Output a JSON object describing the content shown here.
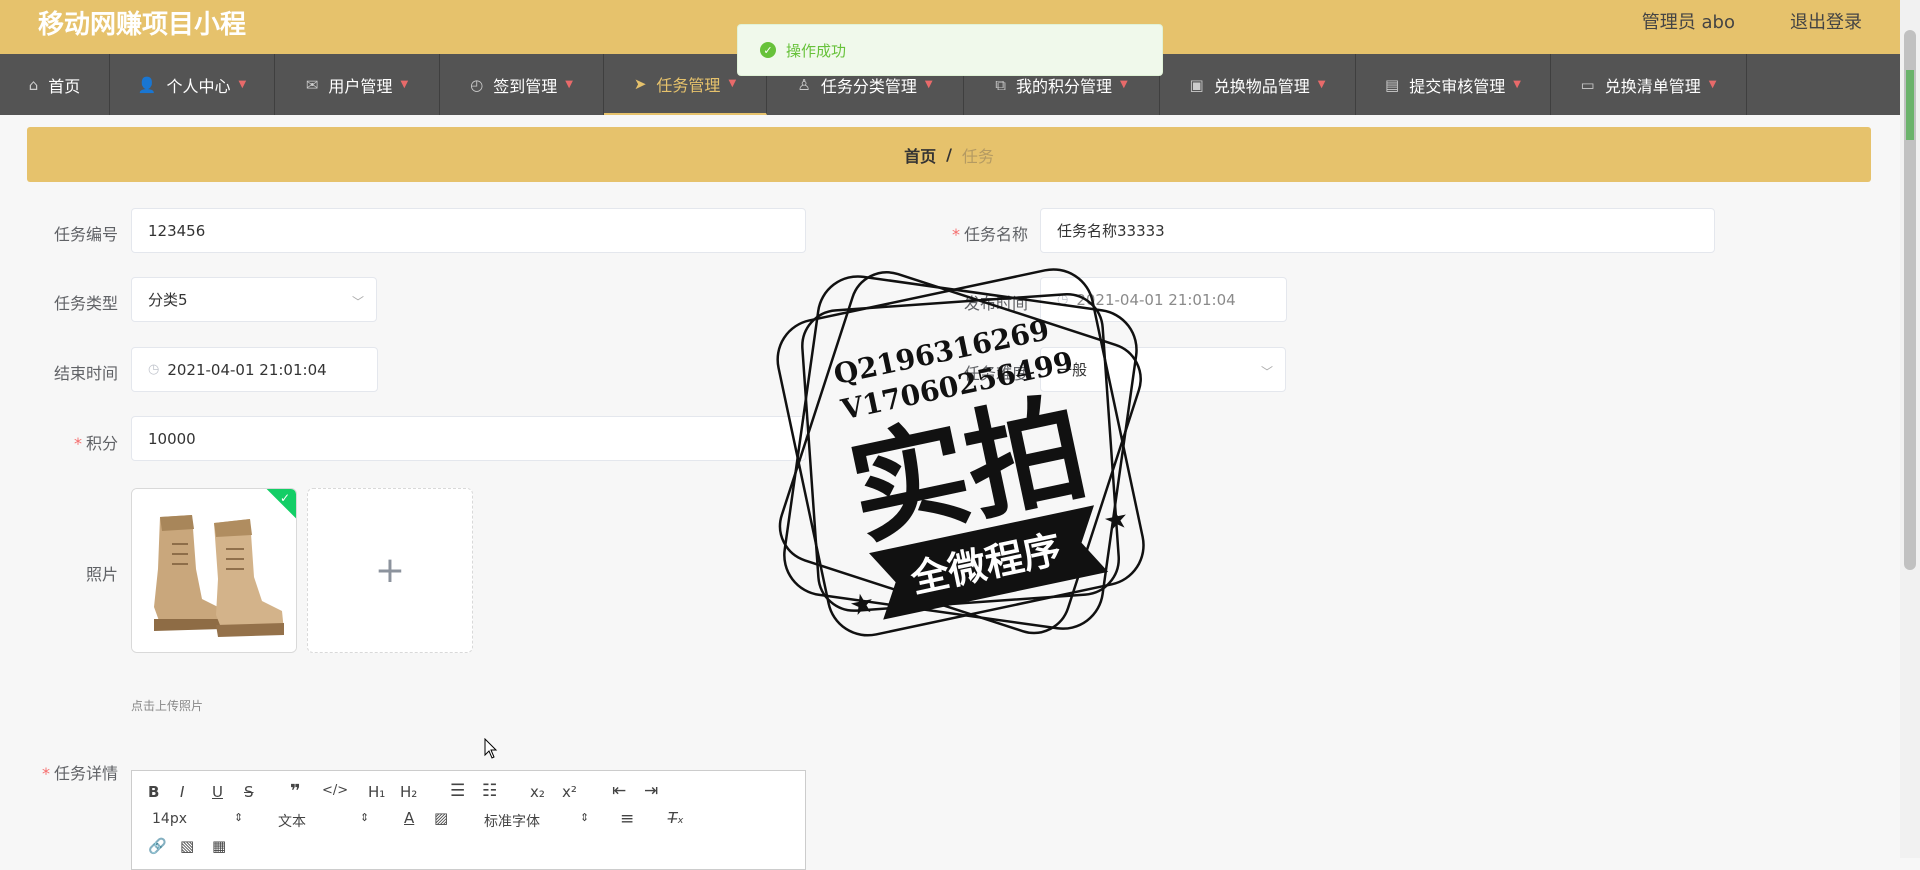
{
  "header": {
    "app_title": "移动网赚项目小程",
    "admin_label": "管理员 abo",
    "logout_label": "退出登录"
  },
  "nav": {
    "items": [
      {
        "label": "首页",
        "icon": "home-icon",
        "has_chevron": false
      },
      {
        "label": "个人中心",
        "icon": "user-icon",
        "has_chevron": true
      },
      {
        "label": "用户管理",
        "icon": "mail-icon",
        "has_chevron": true
      },
      {
        "label": "签到管理",
        "icon": "compass-icon",
        "has_chevron": true
      },
      {
        "label": "任务管理",
        "icon": "paper-plane-icon",
        "has_chevron": true,
        "active": true
      },
      {
        "label": "任务分类管理",
        "icon": "stamp-icon",
        "has_chevron": true
      },
      {
        "label": "我的积分管理",
        "icon": "crop-icon",
        "has_chevron": true
      },
      {
        "label": "兑换物品管理",
        "icon": "briefcase-icon",
        "has_chevron": true
      },
      {
        "label": "提交审核管理",
        "icon": "clipboard-icon",
        "has_chevron": true
      },
      {
        "label": "兑换清单管理",
        "icon": "monitor-icon",
        "has_chevron": true
      }
    ]
  },
  "breadcrumb": {
    "home": "首页",
    "separator": "/",
    "current": "任务"
  },
  "form": {
    "task_no": {
      "label": "任务编号",
      "value": "123456"
    },
    "task_name": {
      "label": "任务名称",
      "value": "任务名称33333",
      "required": true
    },
    "task_type": {
      "label": "任务类型",
      "value": "分类5"
    },
    "publish_time": {
      "label": "发布时间",
      "value": "2021-04-01 21:01:04"
    },
    "end_time": {
      "label": "结束时间",
      "value": "2021-04-01 21:01:04"
    },
    "difficulty": {
      "label": "任务难度",
      "value": "一般"
    },
    "points": {
      "label": "积分",
      "value": "10000",
      "required": true
    },
    "photo": {
      "label": "照片",
      "tip": "点击上传照片"
    },
    "details": {
      "label": "任务详情",
      "required": true
    }
  },
  "editor": {
    "font_size": "14px",
    "format": "文本",
    "font_family": "标准字体"
  },
  "toast": {
    "message": "操作成功"
  },
  "stamp": {
    "line1": "Q2196316269",
    "line2": "V17060256499",
    "big": "实拍",
    "banner": "全微程序"
  },
  "colors": {
    "accent": "#e6c26c",
    "nav_bg": "#545454",
    "success": "#67c23a",
    "required": "#f56c6c"
  }
}
